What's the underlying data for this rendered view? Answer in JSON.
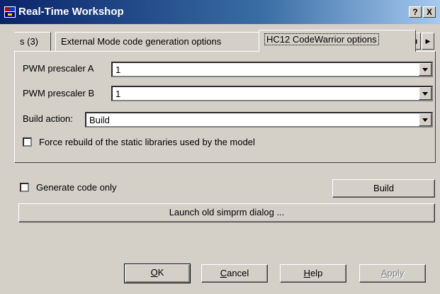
{
  "window": {
    "title": "Real-Time Workshop",
    "help_btn": "?",
    "close_btn": "X"
  },
  "tabs": {
    "items": [
      {
        "label": "s (3)"
      },
      {
        "label": "External Mode code generation options"
      },
      {
        "label": "HC12 CodeWarrior options"
      }
    ],
    "active": 2
  },
  "panel": {
    "pwm_a": {
      "label": "PWM prescaler A",
      "value": "1"
    },
    "pwm_b": {
      "label": "PWM prescaler B",
      "value": "1"
    },
    "build_action": {
      "label": "Build action:",
      "value": "Build"
    },
    "force_rebuild": {
      "label": "Force rebuild of the static libraries used by the model",
      "checked": false
    }
  },
  "generate_code_only": {
    "label": "Generate code only",
    "checked": false
  },
  "buttons": {
    "build": "Build",
    "launch": "Launch old simprm dialog ...",
    "ok_mnemonic": "O",
    "ok_rest": "K",
    "cancel_mnemonic": "C",
    "cancel_rest": "ancel",
    "help_mnemonic": "H",
    "help_rest": "elp",
    "apply_mnemonic": "A",
    "apply_rest": "pply"
  },
  "colors": {
    "face": "#d4d0c8",
    "title_start": "#0a246a",
    "title_end": "#a6caf0"
  }
}
